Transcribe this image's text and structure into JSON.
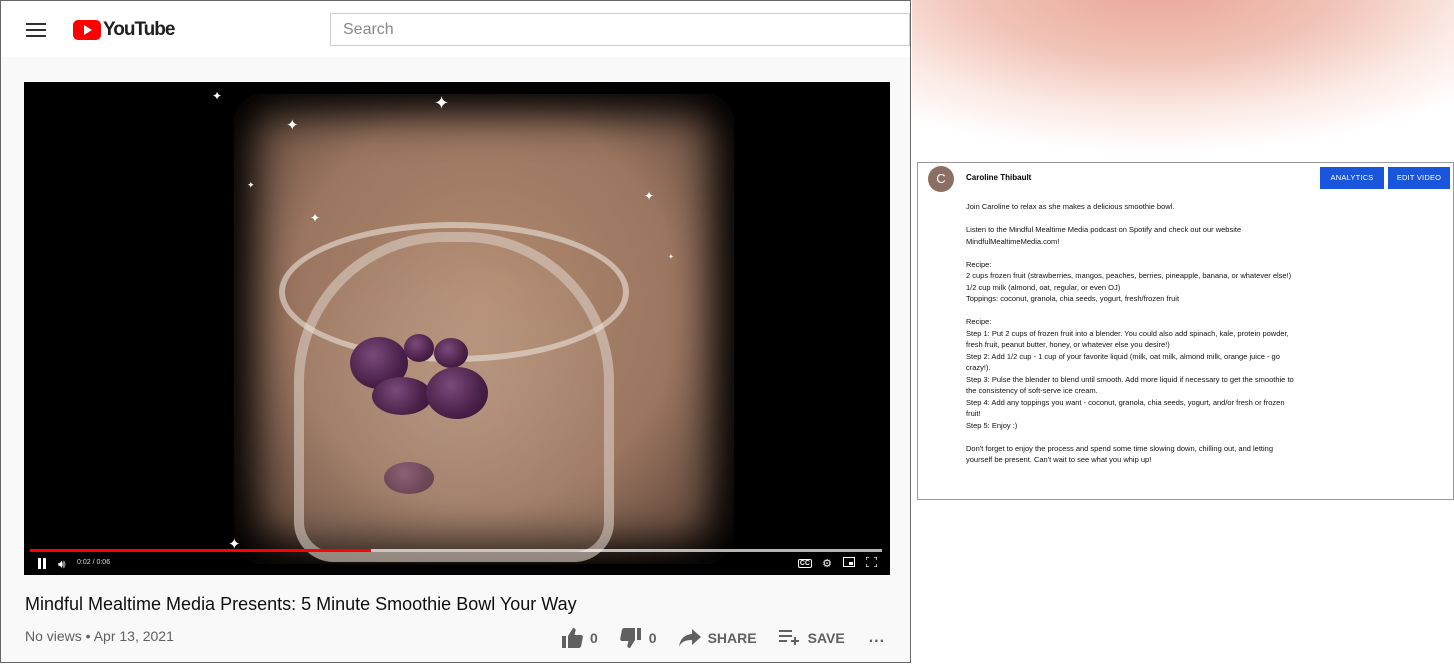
{
  "youtube": {
    "logo_text": "YouTube",
    "search_placeholder": "Search",
    "player": {
      "time": "0:02 / 0:06",
      "progress_fraction": 0.4,
      "buffered_fraction": 1.0,
      "cc_label": "CC"
    },
    "video": {
      "title": "Mindful Mealtime Media Presents: 5 Minute Smoothie Bowl Your Way",
      "meta": "No views • Apr 13, 2021",
      "likes": "0",
      "dislikes": "0",
      "share_label": "SHARE",
      "save_label": "SAVE",
      "more_label": "..."
    },
    "colors": {
      "brand_red": "#ff0000",
      "progress": "#ff0000"
    },
    "icons": [
      "menu-icon",
      "youtube-logo-icon",
      "pause-icon",
      "volume-icon",
      "cc-icon",
      "settings-icon",
      "miniplayer-icon",
      "fullscreen-icon",
      "thumbs-up-icon",
      "thumbs-down-icon",
      "share-icon",
      "save-playlist-icon",
      "more-icon"
    ]
  },
  "description": {
    "avatar_letter": "C",
    "channel_name": "Caroline Thibault",
    "analytics_label": "ANALYTICS",
    "edit_label": "EDIT VIDEO",
    "accent_color": "#1a56db",
    "paragraphs": [
      "Join Caroline to relax as she makes a delicious smoothie bowl.",
      "Listen to the Mindful Mealtime Media podcast on Spotify and check out our website\nMindfulMealtimeMedia.com!",
      "Recipe:\n2 cups frozen fruit (strawberries, mangos, peaches, berries, pineapple, banana, or whatever else!)\n1/2 cup milk (almond, oat, regular, or even OJ)\nToppings: coconut, granola, chia seeds, yogurt, fresh/frozen fruit",
      "Recipe:\nStep 1: Put 2 cups of frozen fruit into a blender. You could also add spinach, kale, protein powder,\nfresh fruit, peanut butter, honey, or whatever else you desire!)\nStep 2: Add 1/2 cup - 1 cup of your favorite liquid (milk, oat milk, almond milk, orange juice - go\ncrazy!).\nStep 3: Pulse the blender to blend until smooth. Add more liquid if necessary to get the smoothie to\nthe consistency of soft-serve ice cream.\nStep 4: Add any toppings you want - coconut, granola, chia seeds, yogurt, and/or fresh or frozen\nfruit!\nStep 5: Enjoy :)",
      "Don't forget to enjoy the process and spend some time slowing down, chilling out, and letting\nyourself be present. Can't wait to see what you whip up!"
    ]
  }
}
